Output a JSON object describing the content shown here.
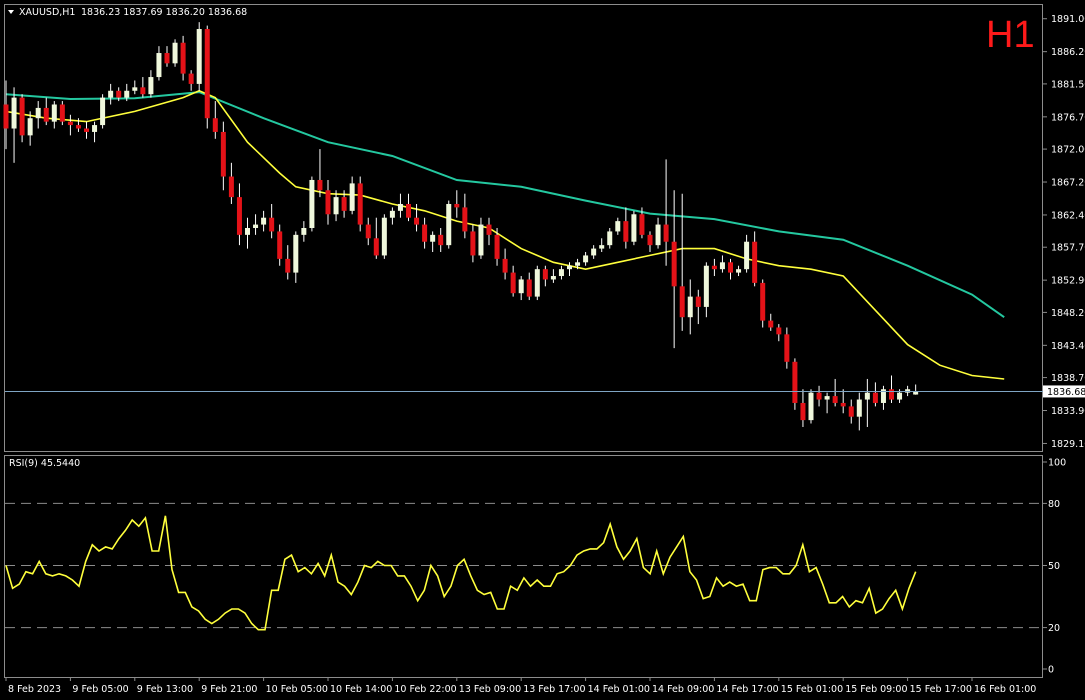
{
  "chart_data": [
    {
      "type": "candlestick",
      "symbol_header": "XAUUSD,H1",
      "ohlc_header": "1836.23 1837.69 1836.20 1836.68",
      "timeframe_label": "H1",
      "ylim": [
        1828.0,
        1893.0
      ],
      "y_ticks": [
        "1891.00",
        "1886.20",
        "1881.50",
        "1876.70",
        "1872.00",
        "1867.20",
        "1862.40",
        "1857.70",
        "1852.90",
        "1848.20",
        "1843.40",
        "1838.70",
        "1833.90",
        "1829.10"
      ],
      "current_price_label": "1836.68",
      "current_price": 1836.68,
      "x_ticks": [
        {
          "label": "8 Feb 2023",
          "i": 0
        },
        {
          "label": "9 Feb 05:00",
          "i": 8
        },
        {
          "label": "9 Feb 13:00",
          "i": 16
        },
        {
          "label": "9 Feb 21:00",
          "i": 24
        },
        {
          "label": "10 Feb 05:00",
          "i": 32
        },
        {
          "label": "10 Feb 14:00",
          "i": 40
        },
        {
          "label": "10 Feb 22:00",
          "i": 48
        },
        {
          "label": "13 Feb 09:00",
          "i": 56
        },
        {
          "label": "13 Feb 17:00",
          "i": 64
        },
        {
          "label": "14 Feb 01:00",
          "i": 72
        },
        {
          "label": "14 Feb 09:00",
          "i": 80
        },
        {
          "label": "14 Feb 17:00",
          "i": 88
        },
        {
          "label": "15 Feb 01:00",
          "i": 96
        },
        {
          "label": "15 Feb 09:00",
          "i": 104
        },
        {
          "label": "15 Feb 17:00",
          "i": 112
        },
        {
          "label": "16 Feb 01:00",
          "i": 120
        }
      ],
      "candles_ohlc": [
        [
          1878.5,
          1882.0,
          1872.0,
          1875.0
        ],
        [
          1875.0,
          1881.0,
          1870.0,
          1879.5
        ],
        [
          1879.5,
          1880.0,
          1873.0,
          1874.0
        ],
        [
          1874.0,
          1877.5,
          1872.5,
          1876.5
        ],
        [
          1876.5,
          1879.0,
          1875.0,
          1878.0
        ],
        [
          1878.0,
          1879.5,
          1875.5,
          1876.0
        ],
        [
          1876.0,
          1879.0,
          1875.0,
          1878.5
        ],
        [
          1878.5,
          1879.0,
          1875.5,
          1876.0
        ],
        [
          1876.0,
          1877.0,
          1874.0,
          1875.5
        ],
        [
          1875.5,
          1876.5,
          1874.5,
          1875.0
        ],
        [
          1875.0,
          1876.0,
          1873.5,
          1874.5
        ],
        [
          1874.5,
          1876.0,
          1873.0,
          1875.5
        ],
        [
          1875.5,
          1880.0,
          1875.0,
          1879.5
        ],
        [
          1879.5,
          1881.5,
          1878.5,
          1880.5
        ],
        [
          1880.5,
          1881.0,
          1879.0,
          1879.5
        ],
        [
          1879.5,
          1881.5,
          1879.0,
          1880.5
        ],
        [
          1880.5,
          1882.0,
          1880.0,
          1881.0
        ],
        [
          1881.0,
          1882.5,
          1879.5,
          1880.0
        ],
        [
          1880.0,
          1883.5,
          1879.5,
          1882.5
        ],
        [
          1882.5,
          1887.0,
          1882.0,
          1886.0
        ],
        [
          1886.0,
          1887.0,
          1884.0,
          1884.5
        ],
        [
          1884.5,
          1888.0,
          1884.0,
          1887.5
        ],
        [
          1887.5,
          1888.5,
          1882.0,
          1883.0
        ],
        [
          1883.0,
          1883.5,
          1880.5,
          1881.5
        ],
        [
          1881.5,
          1890.5,
          1880.5,
          1889.5
        ],
        [
          1889.5,
          1890.0,
          1875.0,
          1876.5
        ],
        [
          1876.5,
          1879.0,
          1873.5,
          1874.5
        ],
        [
          1874.5,
          1876.0,
          1866.0,
          1868.0
        ],
        [
          1868.0,
          1870.0,
          1864.0,
          1865.0
        ],
        [
          1865.0,
          1867.0,
          1858.0,
          1859.5
        ],
        [
          1859.5,
          1862.0,
          1857.5,
          1860.5
        ],
        [
          1860.5,
          1862.5,
          1859.5,
          1861.0
        ],
        [
          1861.0,
          1863.0,
          1860.0,
          1862.0
        ],
        [
          1862.0,
          1864.0,
          1859.0,
          1860.0
        ],
        [
          1860.0,
          1861.0,
          1855.0,
          1856.0
        ],
        [
          1856.0,
          1858.0,
          1853.0,
          1854.0
        ],
        [
          1854.0,
          1860.0,
          1852.5,
          1859.5
        ],
        [
          1859.5,
          1861.5,
          1858.5,
          1860.5
        ],
        [
          1860.5,
          1868.0,
          1860.0,
          1867.5
        ],
        [
          1867.5,
          1872.0,
          1865.0,
          1866.0
        ],
        [
          1866.0,
          1867.5,
          1861.0,
          1862.5
        ],
        [
          1862.5,
          1866.0,
          1861.5,
          1865.0
        ],
        [
          1865.0,
          1866.0,
          1862.0,
          1863.0
        ],
        [
          1863.0,
          1868.0,
          1862.5,
          1867.0
        ],
        [
          1867.0,
          1868.0,
          1860.0,
          1861.0
        ],
        [
          1861.0,
          1862.0,
          1858.0,
          1859.0
        ],
        [
          1859.0,
          1862.0,
          1856.0,
          1856.5
        ],
        [
          1856.5,
          1862.5,
          1856.0,
          1862.0
        ],
        [
          1862.0,
          1863.5,
          1861.0,
          1863.0
        ],
        [
          1863.0,
          1865.5,
          1862.0,
          1864.0
        ],
        [
          1864.0,
          1865.5,
          1861.5,
          1862.0
        ],
        [
          1862.0,
          1864.0,
          1860.0,
          1861.0
        ],
        [
          1861.0,
          1862.0,
          1857.5,
          1858.5
        ],
        [
          1858.5,
          1860.0,
          1857.0,
          1859.5
        ],
        [
          1859.5,
          1860.5,
          1857.0,
          1858.0
        ],
        [
          1858.0,
          1864.5,
          1857.5,
          1864.0
        ],
        [
          1864.0,
          1866.0,
          1862.0,
          1863.5
        ],
        [
          1863.5,
          1865.5,
          1859.0,
          1860.0
        ],
        [
          1860.0,
          1861.0,
          1855.5,
          1856.5
        ],
        [
          1856.5,
          1862.0,
          1856.0,
          1861.0
        ],
        [
          1861.0,
          1862.0,
          1858.0,
          1859.5
        ],
        [
          1859.5,
          1860.5,
          1855.0,
          1856.0
        ],
        [
          1856.0,
          1857.5,
          1853.0,
          1854.0
        ],
        [
          1854.0,
          1855.0,
          1850.5,
          1851.0
        ],
        [
          1851.0,
          1853.5,
          1850.0,
          1853.0
        ],
        [
          1853.0,
          1854.0,
          1850.0,
          1850.5
        ],
        [
          1850.5,
          1855.0,
          1850.0,
          1854.5
        ],
        [
          1854.5,
          1855.0,
          1852.0,
          1853.0
        ],
        [
          1853.0,
          1854.5,
          1852.5,
          1853.5
        ],
        [
          1853.5,
          1855.0,
          1853.0,
          1854.5
        ],
        [
          1854.5,
          1855.5,
          1853.5,
          1855.0
        ],
        [
          1855.0,
          1856.0,
          1854.5,
          1855.5
        ],
        [
          1855.5,
          1857.0,
          1855.0,
          1856.5
        ],
        [
          1856.5,
          1858.0,
          1856.0,
          1857.5
        ],
        [
          1857.5,
          1859.0,
          1857.0,
          1858.0
        ],
        [
          1858.0,
          1860.5,
          1857.5,
          1860.0
        ],
        [
          1860.0,
          1862.0,
          1859.5,
          1861.5
        ],
        [
          1861.5,
          1863.5,
          1857.5,
          1858.5
        ],
        [
          1858.5,
          1863.0,
          1858.0,
          1862.5
        ],
        [
          1862.5,
          1863.5,
          1859.0,
          1859.5
        ],
        [
          1859.5,
          1860.0,
          1857.0,
          1858.0
        ],
        [
          1858.0,
          1862.0,
          1857.5,
          1861.0
        ],
        [
          1861.0,
          1870.5,
          1855.0,
          1858.5
        ],
        [
          1858.5,
          1866.0,
          1843.0,
          1852.0
        ],
        [
          1852.0,
          1865.5,
          1845.5,
          1847.5
        ],
        [
          1847.5,
          1853.0,
          1845.0,
          1850.5
        ],
        [
          1850.5,
          1851.5,
          1846.5,
          1849.0
        ],
        [
          1849.0,
          1855.5,
          1847.5,
          1855.0
        ],
        [
          1855.0,
          1856.0,
          1853.5,
          1854.5
        ],
        [
          1854.5,
          1856.5,
          1854.0,
          1855.5
        ],
        [
          1855.5,
          1856.0,
          1853.0,
          1854.0
        ],
        [
          1854.0,
          1855.0,
          1853.5,
          1854.5
        ],
        [
          1854.5,
          1859.5,
          1854.0,
          1858.5
        ],
        [
          1858.5,
          1860.0,
          1852.0,
          1852.5
        ],
        [
          1852.5,
          1853.0,
          1846.0,
          1847.0
        ],
        [
          1847.0,
          1848.0,
          1845.5,
          1846.0
        ],
        [
          1846.0,
          1846.5,
          1844.0,
          1845.0
        ],
        [
          1845.0,
          1846.0,
          1840.0,
          1841.0
        ],
        [
          1841.0,
          1841.5,
          1834.0,
          1835.0
        ],
        [
          1835.0,
          1837.0,
          1831.5,
          1832.5
        ],
        [
          1832.5,
          1837.0,
          1832.0,
          1836.5
        ],
        [
          1836.5,
          1837.5,
          1834.5,
          1835.5
        ],
        [
          1835.5,
          1836.5,
          1833.5,
          1836.0
        ],
        [
          1836.0,
          1838.5,
          1834.5,
          1835.0
        ],
        [
          1835.0,
          1837.0,
          1833.5,
          1834.5
        ],
        [
          1834.5,
          1835.5,
          1832.0,
          1833.0
        ],
        [
          1833.0,
          1836.5,
          1831.0,
          1835.5
        ],
        [
          1835.5,
          1838.5,
          1831.5,
          1836.5
        ],
        [
          1836.5,
          1838.0,
          1834.5,
          1835.0
        ],
        [
          1835.0,
          1837.5,
          1834.0,
          1837.0
        ],
        [
          1837.0,
          1839.0,
          1835.0,
          1835.5
        ],
        [
          1835.5,
          1837.0,
          1835.0,
          1836.5
        ],
        [
          1836.5,
          1837.5,
          1836.0,
          1837.0
        ],
        [
          1836.23,
          1837.69,
          1836.2,
          1836.68
        ]
      ],
      "ma_slow": [
        [
          0,
          1880.0
        ],
        [
          8,
          1879.3
        ],
        [
          16,
          1879.4
        ],
        [
          24,
          1880.3
        ],
        [
          32,
          1876.5
        ],
        [
          40,
          1873.0
        ],
        [
          48,
          1871.0
        ],
        [
          56,
          1867.5
        ],
        [
          64,
          1866.5
        ],
        [
          72,
          1864.5
        ],
        [
          80,
          1862.6
        ],
        [
          88,
          1861.8
        ],
        [
          96,
          1860.0
        ],
        [
          104,
          1858.8
        ],
        [
          112,
          1855.0
        ],
        [
          120,
          1850.8
        ],
        [
          124,
          1847.5
        ]
      ],
      "ma_fast": [
        [
          0,
          1877.5
        ],
        [
          5,
          1876.5
        ],
        [
          10,
          1876.0
        ],
        [
          16,
          1877.5
        ],
        [
          22,
          1879.5
        ],
        [
          24,
          1880.5
        ],
        [
          26,
          1879.5
        ],
        [
          30,
          1873.0
        ],
        [
          34,
          1868.5
        ],
        [
          36,
          1866.5
        ],
        [
          40,
          1865.5
        ],
        [
          44,
          1865.3
        ],
        [
          48,
          1864.0
        ],
        [
          52,
          1863.0
        ],
        [
          56,
          1861.5
        ],
        [
          60,
          1860.5
        ],
        [
          64,
          1857.5
        ],
        [
          68,
          1855.5
        ],
        [
          72,
          1854.5
        ],
        [
          76,
          1855.5
        ],
        [
          80,
          1856.5
        ],
        [
          84,
          1857.5
        ],
        [
          88,
          1857.5
        ],
        [
          92,
          1856.0
        ],
        [
          96,
          1855.0
        ],
        [
          100,
          1854.5
        ],
        [
          104,
          1853.5
        ],
        [
          108,
          1848.5
        ],
        [
          112,
          1843.5
        ],
        [
          116,
          1840.5
        ],
        [
          120,
          1839.0
        ],
        [
          124,
          1838.5
        ]
      ]
    },
    {
      "type": "line",
      "indicator_label": "RSI(9) 45.5440",
      "ylim": [
        0,
        100
      ],
      "y_ticks": [
        "100",
        "80",
        "50",
        "20",
        "0"
      ],
      "levels": [
        80,
        50,
        20
      ],
      "values": [
        50,
        39,
        41,
        47,
        46,
        52,
        46,
        45,
        46,
        45,
        43,
        40,
        52,
        60,
        57,
        59,
        58,
        63,
        67,
        72,
        69,
        73,
        57,
        57,
        74,
        48,
        37,
        37,
        30,
        28,
        24,
        22,
        24,
        27,
        29,
        29,
        27,
        22,
        19,
        19,
        38,
        38,
        53,
        55,
        47,
        49,
        46,
        51,
        45,
        55,
        42,
        40,
        36,
        42,
        50,
        49,
        52,
        50,
        50,
        45,
        45,
        40,
        33,
        38,
        50,
        45,
        35,
        40,
        50,
        53,
        45,
        38,
        36,
        37,
        29,
        29,
        40,
        38,
        44,
        40,
        43,
        40,
        40,
        46,
        47,
        50,
        55,
        57,
        58,
        58,
        61,
        70,
        59,
        53,
        57,
        63,
        49,
        46,
        57,
        46,
        54,
        59,
        64,
        47,
        43,
        34,
        35,
        44,
        40,
        42,
        40,
        41,
        33,
        33,
        48,
        49,
        49,
        46,
        46,
        50,
        60,
        47,
        49,
        41,
        32,
        32,
        35,
        30,
        33,
        32,
        39,
        27,
        29,
        34,
        38,
        29,
        39,
        47
      ]
    }
  ],
  "colors": {
    "background": "#000000",
    "bull_candle": "#f0f8dc",
    "bear_candle": "#e41218",
    "wick": "#ffffff",
    "ma_slow": "#24c8a0",
    "ma_fast": "#ffff3c",
    "rsi_line": "#ffff3c",
    "grid": "#8c8c8c",
    "price_line": "#7fa5c4",
    "timeframe": "#ff1a1a"
  }
}
